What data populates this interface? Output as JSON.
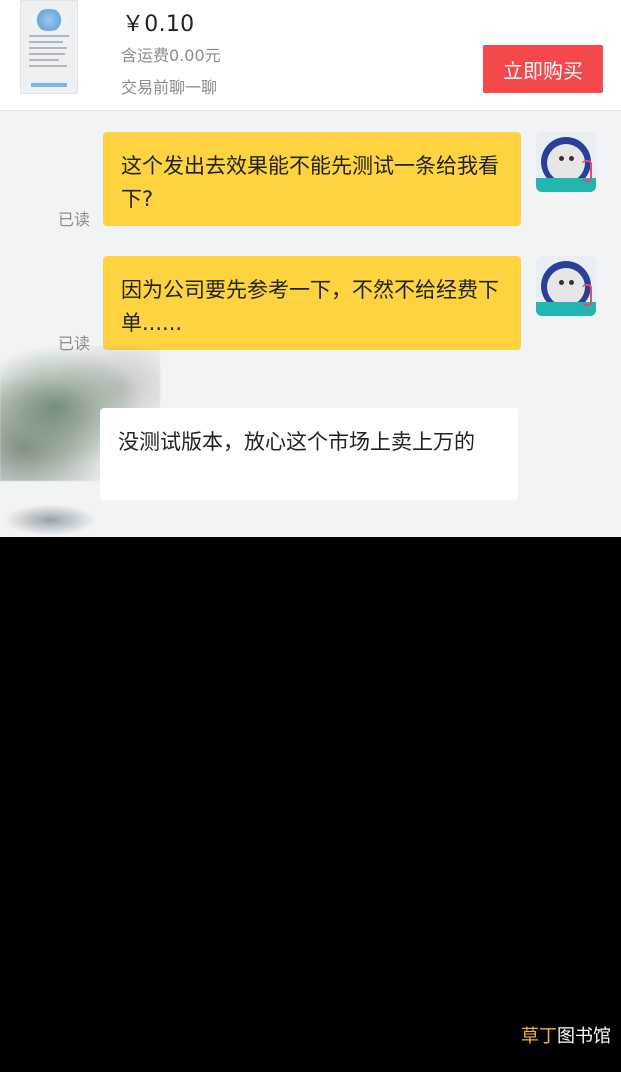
{
  "product": {
    "price": "￥0.10",
    "shipping": "含运费0.00元",
    "chat_before": "交易前聊一聊",
    "buy_button": "立即购买"
  },
  "chat": {
    "messages": [
      {
        "side": "right",
        "status": "已读",
        "text": "这个发出去效果能不能先测试一条给我看下?"
      },
      {
        "side": "right",
        "status": "已读",
        "text": "因为公司要先参考一下，不然不给经费下单......"
      },
      {
        "side": "left",
        "text": "没测试版本，放心这个市场上卖上万的"
      }
    ]
  },
  "watermark": {
    "part1": "草丁",
    "part2": "图书馆"
  },
  "icons": {
    "avatar": "cat-astronaut-icon"
  }
}
